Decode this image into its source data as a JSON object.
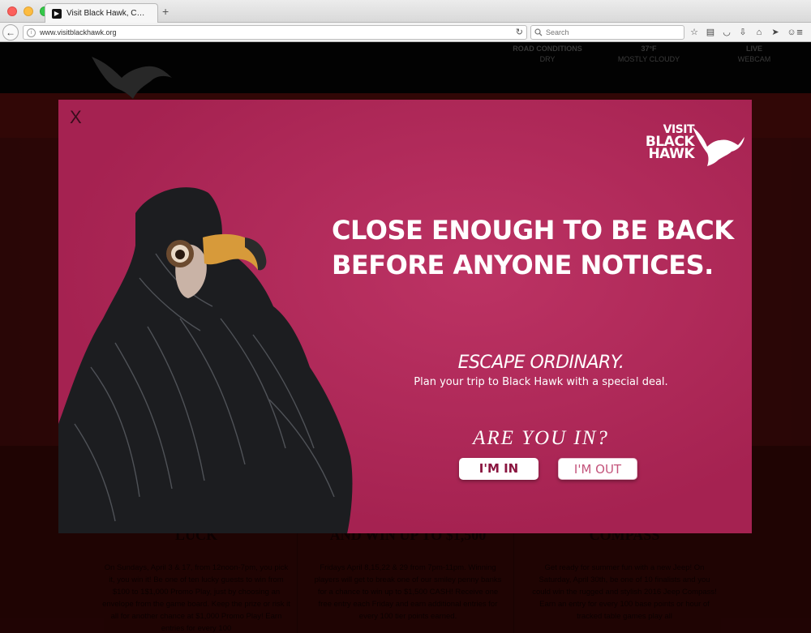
{
  "browser": {
    "tab_title": "Visit Black Hawk, CO - Gam…",
    "new_tab_label": "+",
    "url": "www.visitblackhawk.org",
    "search_placeholder": "Search"
  },
  "site": {
    "status_items": [
      {
        "label": "ROAD CONDITIONS",
        "value": "DRY",
        "icon": "car-icon"
      },
      {
        "label": "37°F",
        "value": "MOSTLY CLOUDY",
        "icon": "sun-icon"
      },
      {
        "label": "LIVE",
        "value": "WEBCAM",
        "icon": "camera-icon"
      }
    ],
    "columns": [
      {
        "heading": "LUCK",
        "body": "On Sundays, April 3 & 17, from 12noon-7pm, you pick it, you win it! Be one of ten lucky guests to win from $100 to 1$1,000 Promo Play, just by choosing an envelope from the game board. Keep the prize or risk it all for another chance at $1,000 Promo Play! Earn entries for every 100"
      },
      {
        "heading": "AND WIN UP TO $1,500",
        "body": "Fridays April 8,15,22 & 29 from 7pm-11pm. Winning players will get to break one of our smiley penny banks for a chance to win up to $1,500 CASH! Receive one free entry each Friday and earn additional entries for every 100 tier points earned."
      },
      {
        "heading": "COMPASS",
        "body": "Get ready for summer fun with a new Jeep! On Saturday, April 30th, be one of 10 finalists and you could win the rugged and stylish 2016 Jeep Compass! Earn an entry for every 100 base points or hour of tracked table games play all"
      }
    ]
  },
  "modal": {
    "close_label": "X",
    "brand": {
      "line1": "VISIT",
      "line2": "BLACK",
      "line3": "HAWK"
    },
    "headline_line1": "CLOSE ENOUGH TO BE BACK",
    "headline_line2": "BEFORE ANYONE NOTICES.",
    "tagline_title": "ESCAPE ORDINARY.",
    "tagline_sub": "Plan your trip to Black Hawk with a special deal.",
    "question": "ARE YOU IN?",
    "btn_in": "I'M IN",
    "btn_out": "I'M OUT"
  },
  "colors": {
    "modal_bg": "#b8265a",
    "btn_in_text": "#8a1640",
    "site_bg": "#3b0807"
  }
}
